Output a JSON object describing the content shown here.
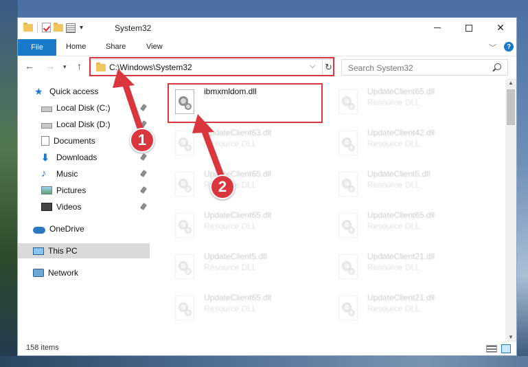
{
  "window": {
    "title": "System32"
  },
  "ribbon": {
    "file_tab": "File",
    "home_tab": "Home",
    "share_tab": "Share",
    "view_tab": "View",
    "help": "?"
  },
  "address": {
    "path": "C:\\Windows\\System32",
    "search_placeholder": "Search System32"
  },
  "navigation": {
    "items": [
      {
        "label": "Quick access",
        "icon": "star-icon"
      },
      {
        "label": "Local Disk (C:)",
        "icon": "disk-icon"
      },
      {
        "label": "Local Disk (D:)",
        "icon": "disk-icon"
      },
      {
        "label": "Documents",
        "icon": "documents-icon"
      },
      {
        "label": "Downloads",
        "icon": "download-icon"
      },
      {
        "label": "Music",
        "icon": "music-icon"
      },
      {
        "label": "Pictures",
        "icon": "pictures-icon"
      },
      {
        "label": "Videos",
        "icon": "videos-icon"
      },
      {
        "label": "OneDrive",
        "icon": "cloud-icon"
      },
      {
        "label": "This PC",
        "icon": "computer-icon"
      },
      {
        "label": "Network",
        "icon": "network-icon"
      }
    ]
  },
  "files": {
    "main": {
      "name": "ibmxmldom.dll"
    },
    "column1": [
      {
        "name": "UpdateClient63.dll",
        "type": "Resource DLL"
      },
      {
        "name": "UpdateClient65.dll",
        "type": "Resource DLL"
      },
      {
        "name": "UpdateClient65.dll",
        "type": "Resource DLL"
      },
      {
        "name": "UpdateClient5.dll",
        "type": "Resource DLL"
      },
      {
        "name": "UpdateClient65.dll",
        "type": "Resource DLL"
      }
    ],
    "column2": [
      {
        "name": "UpdateClient65.dll",
        "type": "Resource DLL"
      },
      {
        "name": "UpdateClient42.dll",
        "type": "Resource DLL"
      },
      {
        "name": "UpdateClient5.dll",
        "type": "Resource DLL"
      },
      {
        "name": "UpdateClient65.dll",
        "type": "Resource DLL"
      },
      {
        "name": "UpdateClient21.dll",
        "type": "Resource DLL"
      },
      {
        "name": "UpdateClient21.dll",
        "type": "Resource DLL"
      }
    ]
  },
  "status": {
    "item_count": "158 items"
  },
  "annotations": {
    "step1": "1",
    "step2": "2",
    "color": "#d9363e"
  }
}
